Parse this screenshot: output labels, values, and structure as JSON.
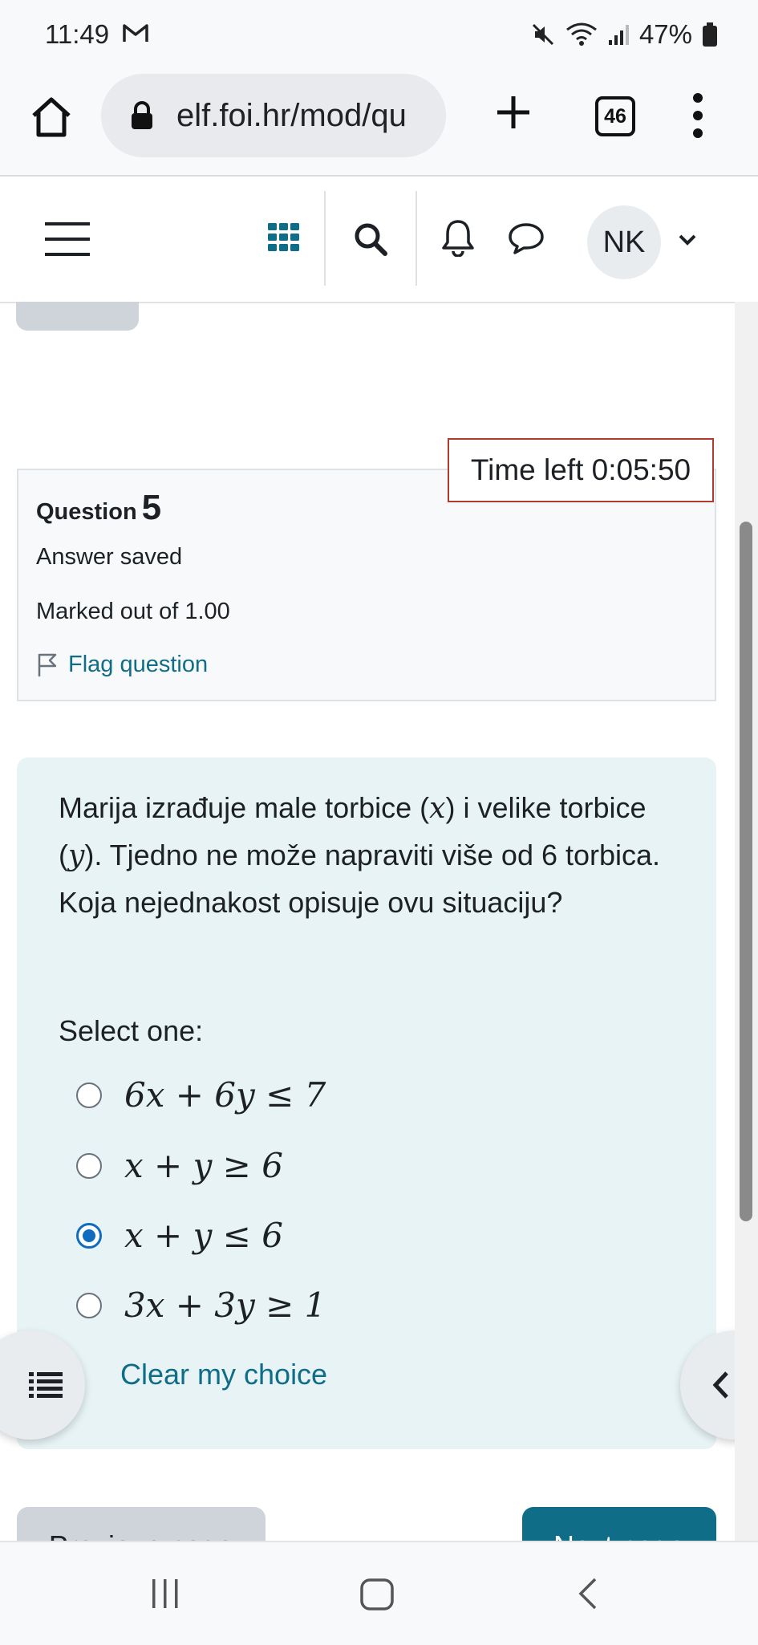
{
  "status_bar": {
    "time": "11:49",
    "battery": "47%",
    "icons": [
      "gmail-icon",
      "mute-icon",
      "wifi-icon",
      "signal-icon",
      "battery-icon"
    ]
  },
  "browser": {
    "url": "elf.foi.hr/mod/qu",
    "tab_count": "46"
  },
  "navbar": {
    "avatar_initials": "NK"
  },
  "timer": {
    "label": "Time left 0:05:50"
  },
  "question_info": {
    "label": "Question",
    "number": "5",
    "state": "Answer saved",
    "grade": "Marked out of 1.00",
    "flag_label": "Flag question"
  },
  "question": {
    "text_part1": "Marija izrađuje male torbice (",
    "var_x": "x",
    "text_part2": ") i velike torbice (",
    "var_y": "y",
    "text_part3": "). Tjedno ne može napraviti više od 6 torbica. Koja nejednakost opisuje ovu situaciju?",
    "prompt": "Select one:",
    "options": [
      {
        "label": "6x + 6y ≤ 7",
        "selected": false
      },
      {
        "label": "x + y ≥ 6",
        "selected": false
      },
      {
        "label": "x + y ≤ 6",
        "selected": true
      },
      {
        "label": "3x + 3y ≥ 1",
        "selected": false
      }
    ],
    "clear_label": "Clear my choice"
  },
  "page_nav": {
    "prev_label": "Previous page",
    "next_label": "Next page"
  },
  "colors": {
    "link": "#0f6d87",
    "radio_selected": "#0f6cbf",
    "timer_border": "#b03a2e",
    "formulation_bg": "#e7f3f5"
  }
}
